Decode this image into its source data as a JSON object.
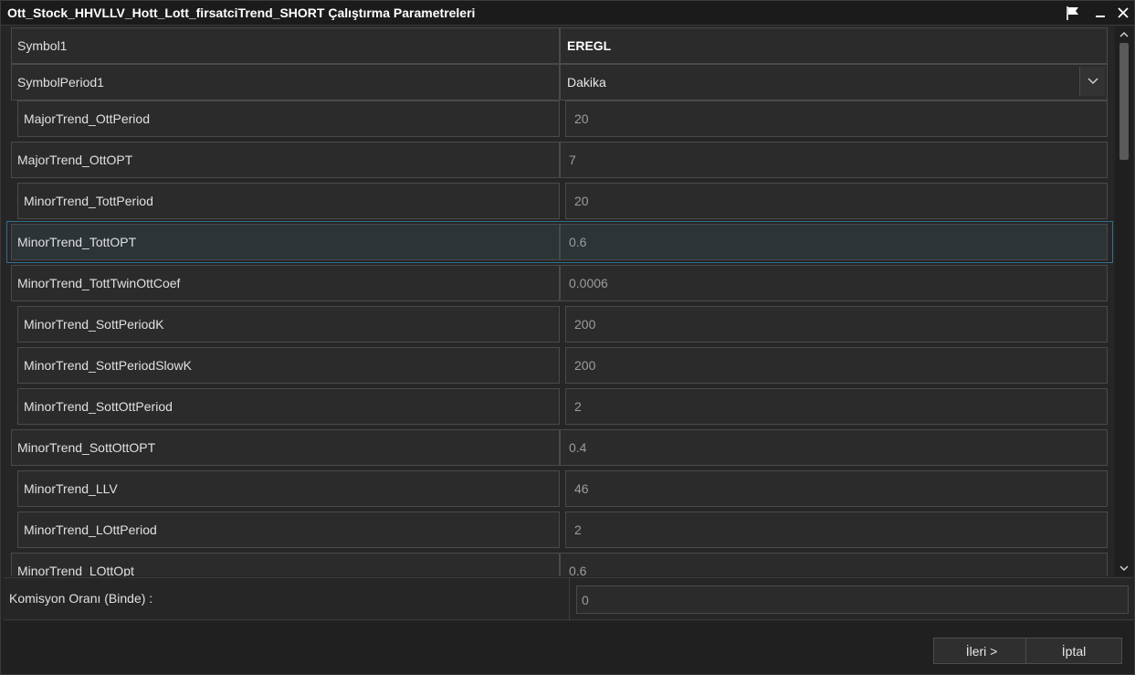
{
  "window": {
    "title": "Ott_Stock_HHVLLV_Hott_Lott_firsatciTrend_SHORT Çalıştırma Parametreleri",
    "icons": [
      "flag-icon",
      "minimize-icon",
      "close-icon"
    ]
  },
  "params": [
    {
      "name": "Symbol1",
      "value": "EREGL",
      "style": "bold",
      "indent": false
    },
    {
      "name": "SymbolPeriod1",
      "value": "Dakika",
      "style": "light",
      "indent": false,
      "dropdown": true
    },
    {
      "name": "MajorTrend_OttPeriod",
      "value": "20",
      "indent": true
    },
    {
      "name": "MajorTrend_OttOPT",
      "value": "7",
      "indent": false
    },
    {
      "name": "MinorTrend_TottPeriod",
      "value": "20",
      "indent": true
    },
    {
      "name": "MinorTrend_TottOPT",
      "value": "0.6",
      "indent": false,
      "selected": true
    },
    {
      "name": "MinorTrend_TottTwinOttCoef",
      "value": "0.0006",
      "indent": false
    },
    {
      "name": "MinorTrend_SottPeriodK",
      "value": "200",
      "indent": true
    },
    {
      "name": "MinorTrend_SottPeriodSlowK",
      "value": "200",
      "indent": true
    },
    {
      "name": "MinorTrend_SottOttPeriod",
      "value": "2",
      "indent": true
    },
    {
      "name": "MinorTrend_SottOttOPT",
      "value": "0.4",
      "indent": false
    },
    {
      "name": "MinorTrend_LLV",
      "value": "46",
      "indent": true
    },
    {
      "name": "MinorTrend_LOttPeriod",
      "value": "2",
      "indent": true
    },
    {
      "name": "MinorTrend_LOttOpt",
      "value": "0.6",
      "indent": false
    }
  ],
  "commission": {
    "label": "Komisyon Oranı (Binde) :",
    "value": "0"
  },
  "buttons": {
    "next": "İleri >",
    "cancel": "İptal"
  },
  "colors": {
    "background": "#252525",
    "selection_border": "#2f6f8f",
    "cell_border": "#4a4a4a"
  }
}
